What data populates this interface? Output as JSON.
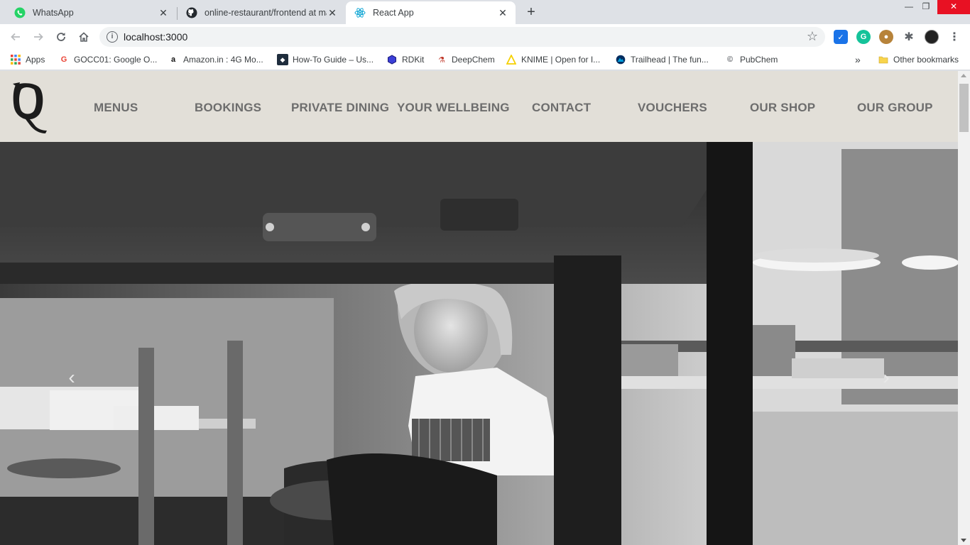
{
  "browser": {
    "tabs": [
      {
        "title": "WhatsApp",
        "icon": "whatsapp-icon"
      },
      {
        "title": "online-restaurant/frontend at ma",
        "icon": "github-icon"
      },
      {
        "title": "React App",
        "icon": "react-icon"
      }
    ],
    "url": "localhost:3000",
    "bookmarks": [
      {
        "label": "Apps",
        "icon": "apps-grid-icon"
      },
      {
        "label": "GOCC01: Google O...",
        "icon": "google-icon"
      },
      {
        "label": "Amazon.in : 4G Mo...",
        "icon": "amazon-icon"
      },
      {
        "label": "How-To Guide – Us...",
        "icon": "shield-bookmark-icon"
      },
      {
        "label": "RDKit",
        "icon": "rdkit-icon"
      },
      {
        "label": "DeepChem",
        "icon": "deepchem-icon"
      },
      {
        "label": "KNIME | Open for I...",
        "icon": "knime-icon"
      },
      {
        "label": "Trailhead | The fun...",
        "icon": "trailhead-icon"
      },
      {
        "label": "PubChem",
        "icon": "pubchem-icon"
      }
    ],
    "more_bookmarks": "»",
    "other_bookmarks": "Other bookmarks"
  },
  "site": {
    "logo_letter": "Q",
    "menu": [
      "MENUS",
      "BOOKINGS",
      "PRIVATE DINING",
      "YOUR WELLBEING",
      "CONTACT",
      "VOUCHERS",
      "OUR SHOP",
      "OUR GROUP"
    ],
    "carousel_prev": "‹",
    "carousel_next": "›"
  },
  "colors": {
    "header_bg": "#e2dfd8",
    "menu_text": "#6d6d6d",
    "tab_strip": "#dee1e6"
  }
}
